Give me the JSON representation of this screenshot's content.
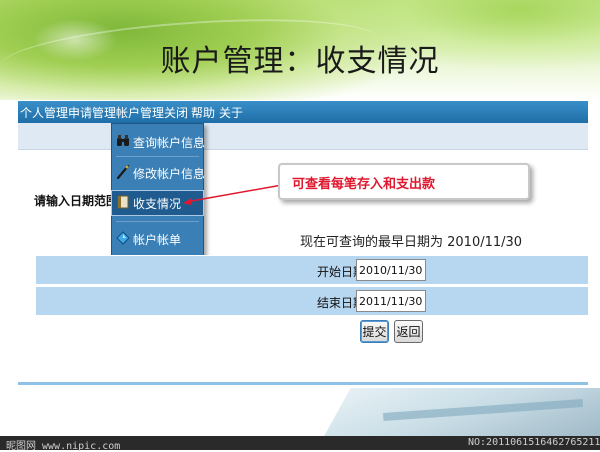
{
  "slide": {
    "title": "账户管理：收支情况"
  },
  "navbar": {
    "items": [
      "个人管理",
      "申请管理",
      "帐户管理",
      "关闭",
      "帮助",
      "关于"
    ]
  },
  "side_label": "请输入日期范围",
  "dropdown": {
    "items": [
      {
        "label": "查询帐户信息",
        "icon": "binoculars-icon"
      },
      {
        "label": "修改帐户信息",
        "icon": "pen-icon"
      },
      {
        "label": "收支情况",
        "icon": "book-icon"
      },
      {
        "label": "帐户帐单",
        "icon": "diamond-icon"
      }
    ],
    "highlighted_index": 2
  },
  "callout": {
    "text": "可查看每笔存入和支出款"
  },
  "query": {
    "earliest_text": "现在可查询的最早日期为  2010/11/30",
    "start_label": "开始日期",
    "start_value": "2010/11/30",
    "end_label": "结束日期",
    "end_value": "2011/11/30",
    "submit_label": "提交",
    "back_label": "返回"
  },
  "watermark": {
    "left": "昵图网 www.nipic.com",
    "right": "NO:20110615164627652112"
  },
  "colors": {
    "nav": "#1f6ea8",
    "menu": "#3a7fb6",
    "row_band": "#b7d6f0",
    "callout_text": "#e0182f"
  }
}
